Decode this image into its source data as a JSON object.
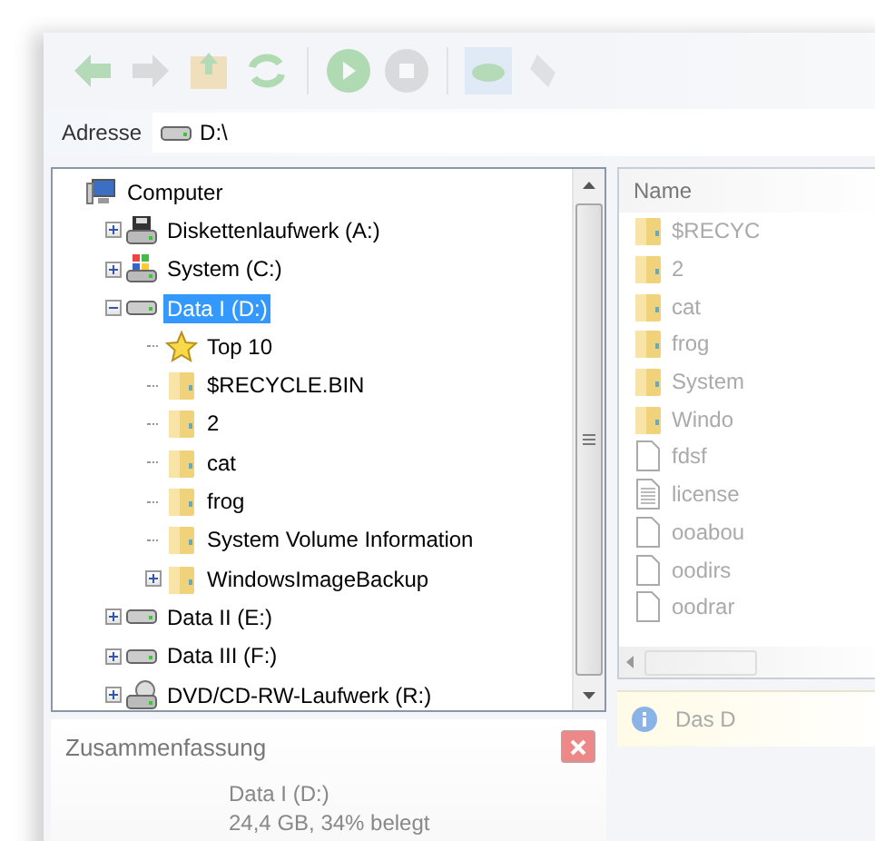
{
  "address": {
    "label": "Adresse",
    "value": "D:\\"
  },
  "tree": [
    {
      "label": "Computer",
      "kind": "computer",
      "selected": false,
      "children": [
        {
          "label": "Diskettenlaufwerk (A:)",
          "kind": "floppy",
          "selected": false,
          "expanded": false
        },
        {
          "label": "System (C:)",
          "kind": "system",
          "selected": false,
          "expanded": false
        },
        {
          "label": "Data I (D:)",
          "kind": "drive",
          "selected": true,
          "expanded": true,
          "children": [
            {
              "label": "Top 10",
              "kind": "star",
              "selected": false
            },
            {
              "label": "$RECYCLE.BIN",
              "kind": "folder",
              "selected": false
            },
            {
              "label": "2",
              "kind": "folder",
              "selected": false
            },
            {
              "label": "cat",
              "kind": "folder",
              "selected": false
            },
            {
              "label": "frog",
              "kind": "folder",
              "selected": false
            },
            {
              "label": "System Volume Information",
              "kind": "folder",
              "selected": false
            },
            {
              "label": "WindowsImageBackup",
              "kind": "folder",
              "selected": false,
              "expanded": false
            }
          ]
        },
        {
          "label": "Data II (E:)",
          "kind": "drive",
          "selected": false,
          "expanded": false
        },
        {
          "label": "Data III (F:)",
          "kind": "drive",
          "selected": false,
          "expanded": false
        },
        {
          "label": "DVD/CD-RW-Laufwerk (R:)",
          "kind": "dvd",
          "selected": false,
          "expanded": false
        }
      ]
    }
  ],
  "list": {
    "column_1": "Name",
    "rows": [
      {
        "name": "$RECYC",
        "kind": "folder"
      },
      {
        "name": "2",
        "kind": "folder"
      },
      {
        "name": "cat",
        "kind": "folder"
      },
      {
        "name": "frog",
        "kind": "folder"
      },
      {
        "name": "System",
        "kind": "folder"
      },
      {
        "name": "Windo",
        "kind": "folder"
      },
      {
        "name": "fdsf",
        "kind": "file"
      },
      {
        "name": "license",
        "kind": "text"
      },
      {
        "name": "ooabou",
        "kind": "file"
      },
      {
        "name": "oodirs",
        "kind": "file"
      },
      {
        "name": "oodrar",
        "kind": "file"
      }
    ]
  },
  "info_bar": "Das D",
  "summary": {
    "title": "Zusammenfassung",
    "name": "Data I (D:)",
    "detail": "24,4 GB, 34% belegt"
  }
}
